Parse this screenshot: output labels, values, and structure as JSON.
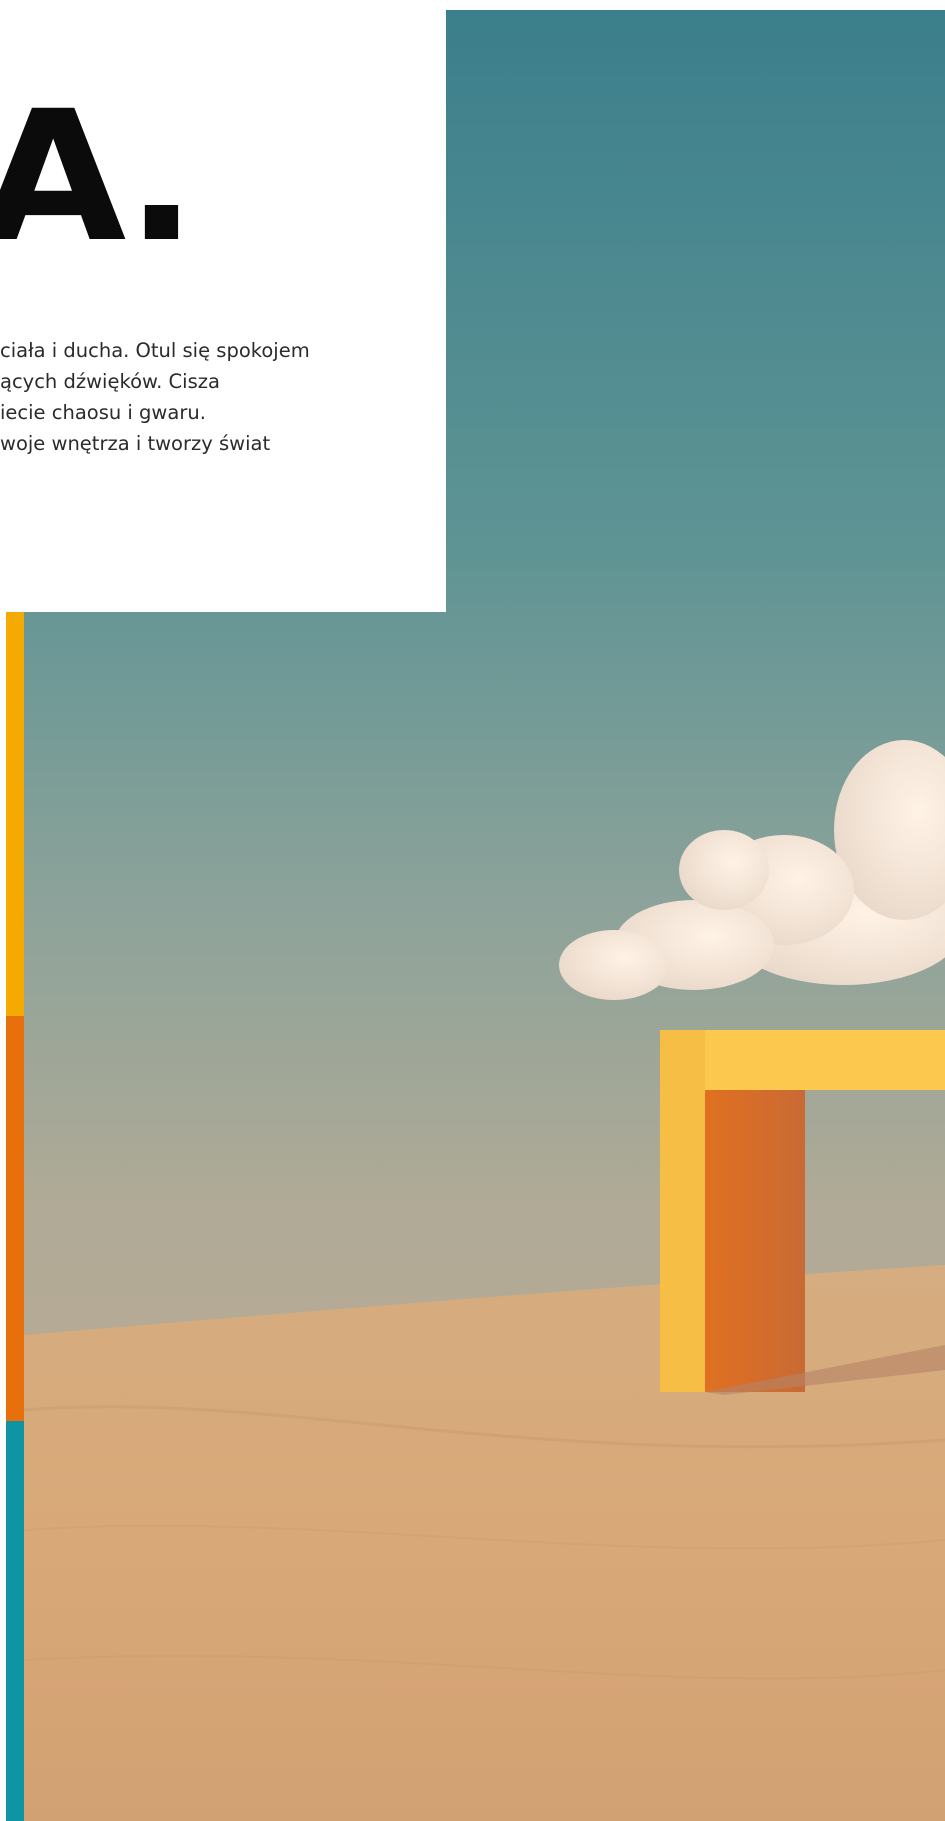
{
  "headline": "A.",
  "body_lines": [
    "ciała i ducha. Otul się spokojem",
    "ących dźwięków. Cisza",
    "iecie chaosu i gwaru.",
    "woje wnętrza i tworzy świat"
  ],
  "colors": {
    "bar_yellow": "#f4aa00",
    "bar_orange": "#e8700c",
    "bar_teal": "#0e94a3",
    "sky_top": "#3b7f8c",
    "sand": "#d6a878",
    "structure_yellow": "#fcc94e",
    "structure_orange": "#d7732d"
  }
}
